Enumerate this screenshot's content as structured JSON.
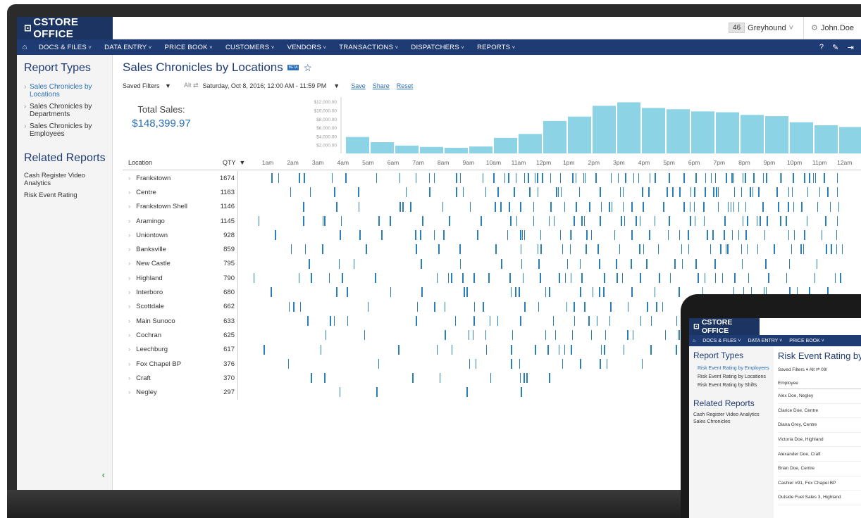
{
  "app": {
    "logo": "CSTORE OFFICE"
  },
  "topbar": {
    "store_number": "46",
    "store_name": "Greyhound",
    "user": "John.Doe"
  },
  "nav": [
    "DOCS & FILES",
    "DATA ENTRY",
    "PRICE BOOK",
    "CUSTOMERS",
    "VENDORS",
    "TRANSACTIONS",
    "DISPATCHERS",
    "REPORTS"
  ],
  "sidebar": {
    "title": "Report Types",
    "items": [
      {
        "label": "Sales Chronicles by Locations",
        "active": true
      },
      {
        "label": "Sales Chronicles by Departments",
        "active": false
      },
      {
        "label": "Sales Chronicles by Employees",
        "active": false
      }
    ],
    "related_title": "Related Reports",
    "related": [
      "Cash Register Video Analytics",
      "Risk Event Rating"
    ]
  },
  "page": {
    "title": "Sales Chronicles by Locations",
    "badge": "BETA",
    "saved_filters": "Saved Filters",
    "alt": "Alt",
    "date_range": "Saturday, Oct 8, 2016; 12:00 AM - 11:59 PM",
    "save": "Save",
    "share": "Share",
    "reset": "Reset"
  },
  "summary": {
    "label": "Total Sales:",
    "value": "$148,399.97"
  },
  "table": {
    "col_location": "Location",
    "col_qty": "QTY"
  },
  "chart_data": {
    "type": "bar",
    "categories": [
      "12am",
      "1am",
      "2am",
      "3am",
      "4am",
      "5am",
      "6am",
      "7am",
      "8am",
      "9am",
      "10am",
      "11am",
      "12pm",
      "1pm",
      "2pm",
      "3pm",
      "4pm",
      "5pm",
      "6pm",
      "7pm",
      "8pm",
      "9pm",
      "10pm",
      "11pm"
    ],
    "values": [
      3800,
      2600,
      1800,
      1500,
      1300,
      1600,
      3600,
      4500,
      7500,
      8500,
      11000,
      11800,
      10500,
      10200,
      9700,
      9500,
      8900,
      8600,
      7200,
      6500,
      6100,
      5600,
      4900,
      4200
    ],
    "y_ticks": [
      "$12,000.00",
      "$10,000.00",
      "$8,000.00",
      "$6,000.00",
      "$4,000.00",
      "$2,000.00"
    ],
    "x_ticks": [
      "1am",
      "2am",
      "3am",
      "4am",
      "5am",
      "6am",
      "7am",
      "8am",
      "9am",
      "10am",
      "11am",
      "12pm",
      "1pm",
      "2pm",
      "3pm",
      "4pm",
      "5pm",
      "6pm",
      "7pm",
      "8pm",
      "9pm",
      "10pm",
      "11pm",
      "12am"
    ],
    "ylim": [
      0,
      13000
    ],
    "color": "#8dd3e6"
  },
  "locations": [
    {
      "name": "Frankstown",
      "qty": "1674"
    },
    {
      "name": "Centre",
      "qty": "1163"
    },
    {
      "name": "Frankstown Shell",
      "qty": "1146"
    },
    {
      "name": "Aramingo",
      "qty": "1145"
    },
    {
      "name": "Uniontown",
      "qty": "928"
    },
    {
      "name": "Banksville",
      "qty": "859"
    },
    {
      "name": "New Castle",
      "qty": "795"
    },
    {
      "name": "Highland",
      "qty": "790"
    },
    {
      "name": "Interboro",
      "qty": "680"
    },
    {
      "name": "Scottdale",
      "qty": "662"
    },
    {
      "name": "Main Sunoco",
      "qty": "633"
    },
    {
      "name": "Cochran",
      "qty": "625"
    },
    {
      "name": "Leechburg",
      "qty": "617"
    },
    {
      "name": "Fox Chapel BP",
      "qty": "376"
    },
    {
      "name": "Craft",
      "qty": "370"
    },
    {
      "name": "Negley",
      "qty": "297"
    }
  ],
  "colors": {
    "navy": "#1f3b73",
    "accent": "#2a6fb8",
    "bar": "#8dd3e6",
    "strip": "#2a7fb8"
  },
  "tablet": {
    "logo": "CSTORE OFFICE",
    "nav": [
      "DOCS & FILES",
      "DATA ENTRY",
      "PRICE BOOK"
    ],
    "side_title": "Report Types",
    "items": [
      "Risk Event Rating by Employees",
      "Risk Event Rating by Locations",
      "Risk Event Rating by Shifts"
    ],
    "related_title": "Related Reports",
    "related": [
      "Cash Register Video Analytics",
      "Sales Chronicles"
    ],
    "title": "Risk Event Rating by",
    "filter": "Saved Filters   ▾   Alt ⇄ 09/",
    "col": "Employee",
    "rows": [
      "Alex Doe, Negley",
      "Clarice Doe, Centre",
      "Diana Grey, Centre",
      "Victoria Doe, Highland",
      "Alexander Doe, Craft",
      "Brian Doe, Centre",
      "Cashier #91, Fox Chapel BP",
      "Outside Fuel Sales 3, Highland"
    ]
  }
}
